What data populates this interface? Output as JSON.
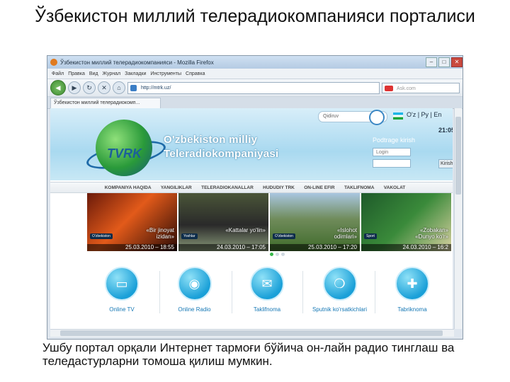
{
  "slide": {
    "title": "Ўзбекистон миллий телерадиокомпанияси порталиси",
    "caption": "Ушбу портал орқали Интернет тармоғи бўйича он-лайн радио тинглаш ва теледастурларни томоша қилиш мумкин."
  },
  "browser": {
    "window_title": "Ўзбекистон миллий телерадиокомпанияси - Mozilla Firefox",
    "controls": {
      "minimize": "–",
      "maximize": "□",
      "close": "✕"
    },
    "menu": [
      "Файл",
      "Правка",
      "Вид",
      "Журнал",
      "Закладки",
      "Инструменты",
      "Справка"
    ],
    "nav": {
      "back": "◀",
      "forward": "▶",
      "reload": "↻",
      "stop": "✕",
      "home": "⌂"
    },
    "url": "http://mtrk.uz/",
    "search_placeholder": "Ask.com",
    "tab_label": "Ўзбекистон миллий телерадиокомп..."
  },
  "site": {
    "logo_text": "TVRK",
    "brand_line1": "O'zbekiston milliy",
    "brand_line2": "Teleradiokompaniyasi",
    "search_placeholder": "Qidiruv",
    "lang": "O'z | Ру | En",
    "time": "21:05",
    "login_title": "Podtrage kirish",
    "login_placeholder": "Login",
    "login_button": "Kirish",
    "nav_items": [
      "KOMPANIYA HAQIDA",
      "YANGILIKLAR",
      "TELERADIOKANALLAR",
      "HUDUDIY TRK",
      "ON-LINE EFIR",
      "TAKLIFNOMA",
      "VAKOLAT"
    ],
    "slides": [
      {
        "channel": "O'zbekiston",
        "title": "«Bir jinoyat\nizidan»",
        "date": "25.03.2010 – 18:55"
      },
      {
        "channel": "Yoshlar",
        "title": "«Kattalar yo'lin»",
        "date": "24.03.2010 – 17:05"
      },
      {
        "channel": "O'zbekiston",
        "title": "«Islohot\nodimlari»",
        "date": "25.03.2010 – 17:20"
      },
      {
        "channel": "Sport",
        "title": "«Zobakan»\n«Dunyo ko'r»",
        "date": "24.03.2010 – 16:2"
      }
    ],
    "services": [
      {
        "icon": "tv-icon",
        "glyph": "▭",
        "label": "Online TV"
      },
      {
        "icon": "radio-icon",
        "glyph": "◉",
        "label": "Online Radio"
      },
      {
        "icon": "mail-icon",
        "glyph": "✉",
        "label": "Taklifnoma"
      },
      {
        "icon": "chat-icon",
        "glyph": "❍",
        "label": "Sputnik ko'rsatkichlari"
      },
      {
        "icon": "gift-icon",
        "glyph": "✚",
        "label": "Tabriknoma"
      }
    ]
  }
}
